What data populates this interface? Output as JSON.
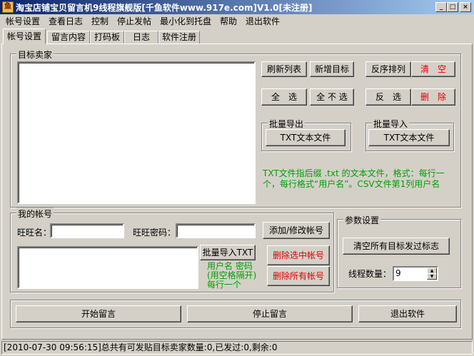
{
  "window": {
    "title": "淘宝店铺宝贝留言机9线程旗舰版[千鱼软件www.917e.com]V1.0[未注册]",
    "app_icon_glyph": "鱼",
    "minimize_glyph": "_",
    "maximize_glyph": "□",
    "close_glyph": "×"
  },
  "menu": [
    {
      "label": "帐号设置"
    },
    {
      "label": "查看日志"
    },
    {
      "label": "控制"
    },
    {
      "label": "停止发帖"
    },
    {
      "label": "最小化到托盘"
    },
    {
      "label": "帮助"
    },
    {
      "label": "退出软件"
    }
  ],
  "tabs": [
    {
      "label": "帐号设置",
      "active": true
    },
    {
      "label": "留言内容"
    },
    {
      "label": "打码板"
    },
    {
      "label": "日志"
    },
    {
      "label": "软件注册"
    }
  ],
  "target_group": {
    "title": "目标卖家",
    "refresh_label": "刷新列表",
    "add_label": "新增目标",
    "reverse_label": "反序排列",
    "clear_label": "清　空",
    "select_all_label": "全　选",
    "deselect_all_label": "全 不 选",
    "invert_label": "反　选",
    "delete_label": "删　除",
    "export_title": "批量导出",
    "export_button": "TXT文本文件",
    "import_title": "批量导入",
    "import_button": "TXT文本文件",
    "hint": "TXT文件指后缀 .txt 的文本文件，格式：每行一个，每行格式“用户名”。CSV文件第1列用户名"
  },
  "account_group": {
    "title": "我的帐号",
    "wangwang_label": "旺旺名：",
    "wangwang_value": "",
    "password_label": "旺旺密码：",
    "password_value": "",
    "add_modify_label": "添加/修改帐号",
    "batch_import_label": "批量导入TXT",
    "delete_selected_label": "删除选中帐号",
    "delete_all_label": "删除所有帐号",
    "format_hint": "用户名 密码\n(用空格隔开)\n每行一个"
  },
  "params_group": {
    "title": "参数设置",
    "clear_flags_label": "清空所有目标发过标志",
    "thread_label": "线程数量：",
    "thread_value": "9"
  },
  "actions": {
    "start_label": "开始留言",
    "stop_label": "停止留言",
    "exit_label": "退出软件"
  },
  "status": {
    "text": "[2010-07-30 09:56:15]总共有可发贴目标卖家数量:0,已发过:0,剩余:0"
  },
  "colors": {
    "titlebar_start": "#0a246a",
    "titlebar_end": "#a6caf0",
    "face": "#d4d0c8",
    "danger": "#e00000",
    "hint_green": "#00a000"
  }
}
